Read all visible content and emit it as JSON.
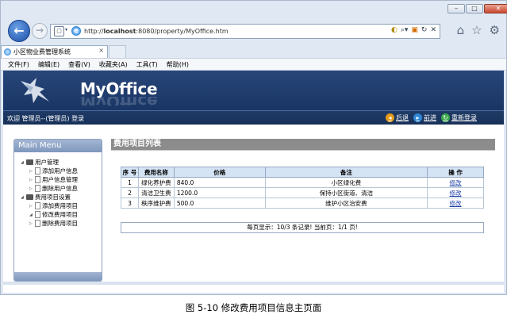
{
  "browser": {
    "url_prefix": "http://",
    "url_host": "localhost",
    "url_rest": ":8080/property/MyOffice.htm",
    "tab_title": "小区物业费管理系统",
    "tab_close": "×",
    "menu": [
      "文件(F)",
      "编辑(E)",
      "查看(V)",
      "收藏夹(A)",
      "工具(T)",
      "帮助(H)"
    ]
  },
  "header": {
    "logo": "MyOffice",
    "welcome": "欢迎 管理员--(管理员) 登录",
    "nav": [
      {
        "label": "后退",
        "icon": "back-arrow-icon"
      },
      {
        "label": "前进",
        "icon": "forward-arrow-icon"
      },
      {
        "label": "重新登录",
        "icon": "relogin-icon"
      }
    ]
  },
  "sidebar": {
    "title": "Main Menu",
    "groups": [
      {
        "label": "用户管理",
        "items": [
          "添加用户信息",
          "用户信息管理",
          "删除用户信息"
        ]
      },
      {
        "label": "费用项目设置",
        "items": [
          "添加费用项目",
          "修改费用项目",
          "删除费用项目"
        ]
      }
    ]
  },
  "main": {
    "title": "费用项目列表",
    "columns": [
      "序 号",
      "费用名称",
      "价格",
      "备注",
      "操 作"
    ],
    "rows": [
      {
        "no": "1",
        "name": "绿化养护费",
        "price": "840.0",
        "note": "小区绿化费",
        "action": "修改"
      },
      {
        "no": "2",
        "name": "清洁卫生费",
        "price": "1200.0",
        "note": "保持小区街道、清洁",
        "action": "修改"
      },
      {
        "no": "3",
        "name": "秩序维护费",
        "price": "500.0",
        "note": "维护小区治安费",
        "action": "修改"
      }
    ],
    "pager": "每页显示：10/3 条记录! 当前页：1/1 页!"
  },
  "caption": "图 5-10 修改费用项目信息主页面"
}
